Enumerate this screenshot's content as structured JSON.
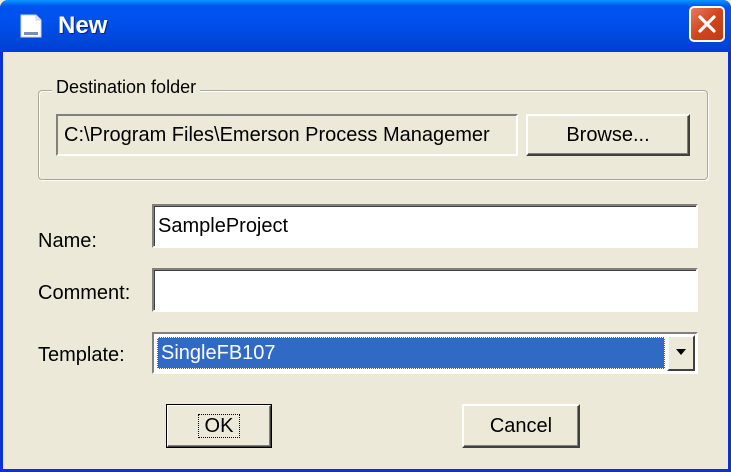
{
  "window": {
    "title": "New",
    "icon": "new-document-icon",
    "close_icon": "close-icon"
  },
  "destination": {
    "group_label": "Destination folder",
    "path": "C:\\Program Files\\Emerson Process Managemer",
    "browse_label": "Browse..."
  },
  "form": {
    "name_label": "Name:",
    "name_value": "SampleProject",
    "comment_label": "Comment:",
    "comment_value": "",
    "template_label": "Template:",
    "template_value": "SingleFB107"
  },
  "buttons": {
    "ok_label": "OK",
    "cancel_label": "Cancel"
  },
  "colors": {
    "titlebar": "#0054e3",
    "selection": "#316ac5",
    "close": "#d0461d",
    "face": "#ece9d8"
  }
}
